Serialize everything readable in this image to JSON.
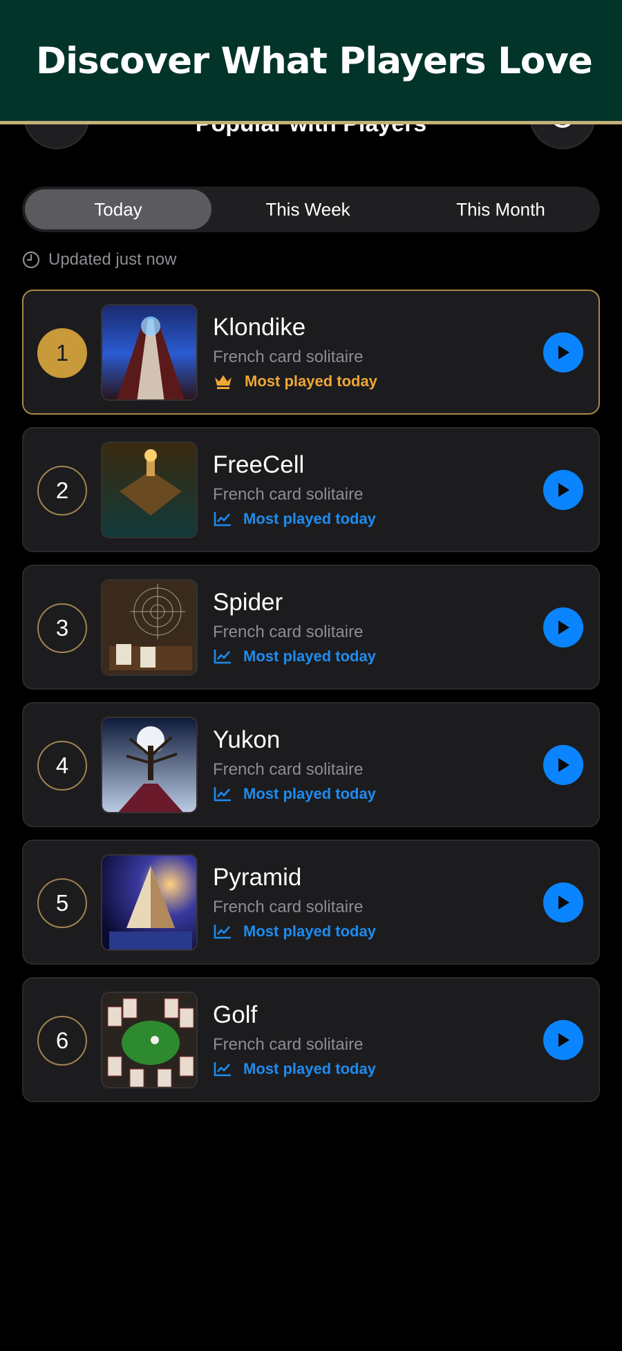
{
  "banner": {
    "title": "Discover What Players Love"
  },
  "nav": {
    "title": "Popular with Players"
  },
  "tabs": [
    {
      "label": "Today",
      "active": true
    },
    {
      "label": "This Week",
      "active": false
    },
    {
      "label": "This Month",
      "active": false
    }
  ],
  "updated": {
    "text": "Updated just now",
    "icon": "clock-icon"
  },
  "colors": {
    "accent": "#0a84ff",
    "gold": "#c99a3a",
    "trend": "#1e8cf0",
    "crown": "#efa735",
    "banner": "#03342a"
  },
  "games": [
    {
      "rank": "1",
      "name": "Klondike",
      "subtitle": "French card solitaire",
      "badge": "Most played today",
      "badge_icon": "crown-icon"
    },
    {
      "rank": "2",
      "name": "FreeCell",
      "subtitle": "French card solitaire",
      "badge": "Most played today",
      "badge_icon": "trend-up-icon"
    },
    {
      "rank": "3",
      "name": "Spider",
      "subtitle": "French card solitaire",
      "badge": "Most played today",
      "badge_icon": "trend-up-icon"
    },
    {
      "rank": "4",
      "name": "Yukon",
      "subtitle": "French card solitaire",
      "badge": "Most played today",
      "badge_icon": "trend-up-icon"
    },
    {
      "rank": "5",
      "name": "Pyramid",
      "subtitle": "French card solitaire",
      "badge": "Most played today",
      "badge_icon": "trend-up-icon"
    },
    {
      "rank": "6",
      "name": "Golf",
      "subtitle": "French card solitaire",
      "badge": "Most played today",
      "badge_icon": "trend-up-icon"
    }
  ]
}
